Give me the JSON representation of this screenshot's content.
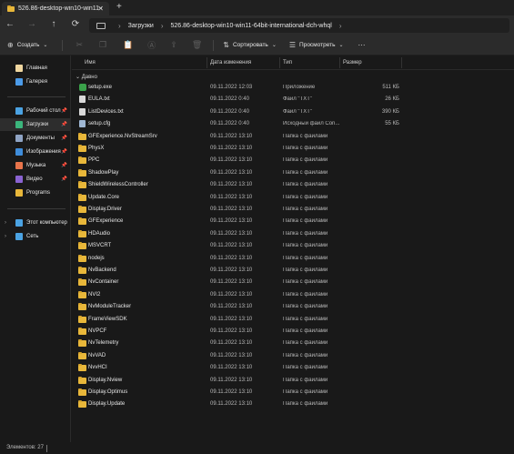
{
  "tab": {
    "title": "526.86-desktop-win10-win11-64...",
    "close": "✕",
    "new": "+"
  },
  "nav": {
    "back": "←",
    "forward": "→",
    "up": "↑",
    "refresh": "⟳"
  },
  "address": {
    "sep": "›",
    "crumbs": [
      "Загрузки",
      "526.86-desktop-win10-win11-64bit-international-dch-whql"
    ]
  },
  "commands": {
    "create": "Создать",
    "sort": "Сортировать",
    "view": "Просмотреть",
    "more": "···"
  },
  "sidebar": {
    "items": [
      {
        "label": "Главная",
        "icon": "home-icon",
        "color": "#f0d7a0"
      },
      {
        "label": "Галерея",
        "icon": "gallery-icon",
        "color": "#4c9be8"
      },
      {
        "label": "Рабочий стол",
        "icon": "desktop-icon",
        "color": "#4ba3e3",
        "pinned": true
      },
      {
        "label": "Загрузки",
        "icon": "downloads-icon",
        "color": "#3bb57c",
        "pinned": true
      },
      {
        "label": "Документы",
        "icon": "documents-icon",
        "color": "#8fa4c4",
        "pinned": true
      },
      {
        "label": "Изображения",
        "icon": "pictures-icon",
        "color": "#3f8ddb",
        "pinned": true
      },
      {
        "label": "Музыка",
        "icon": "music-icon",
        "color": "#e8744b",
        "pinned": true
      },
      {
        "label": "Видео",
        "icon": "videos-icon",
        "color": "#8a63d2",
        "pinned": true
      },
      {
        "label": "Programs",
        "icon": "folder-icon",
        "color": "#e8b73a"
      },
      {
        "label": "Этот компьютер",
        "icon": "this-pc-icon",
        "color": "#4ba3e3"
      },
      {
        "label": "Сеть",
        "icon": "network-icon",
        "color": "#4ba3e3"
      }
    ],
    "pin_glyph": "📌",
    "chevron": "›"
  },
  "columns": {
    "name": "Имя",
    "date": "Дата изменения",
    "type": "Тип",
    "size": "Размер"
  },
  "group": {
    "label": "Давно",
    "chevron": "⌄"
  },
  "files": [
    {
      "name": "setup.exe",
      "date": "09.11.2022 12:03",
      "type": "Приложение",
      "size": "511 КБ",
      "kind": "exe"
    },
    {
      "name": "EULA.txt",
      "date": "09.11.2022 0:40",
      "type": "Файл \"TXT\"",
      "size": "26 КБ",
      "kind": "txt"
    },
    {
      "name": "ListDevices.txt",
      "date": "09.11.2022 0:40",
      "type": "Файл \"TXT\"",
      "size": "390 КБ",
      "kind": "txt"
    },
    {
      "name": "setup.cfg",
      "date": "09.11.2022 0:40",
      "type": "Исходный файл Con...",
      "size": "55 КБ",
      "kind": "cfg"
    },
    {
      "name": "GFExperience.NvStreamSrv",
      "date": "09.11.2022 13:10",
      "type": "Папка с файлами",
      "size": "",
      "kind": "folder"
    },
    {
      "name": "PhysX",
      "date": "09.11.2022 13:10",
      "type": "Папка с файлами",
      "size": "",
      "kind": "folder"
    },
    {
      "name": "PPC",
      "date": "09.11.2022 13:10",
      "type": "Папка с файлами",
      "size": "",
      "kind": "folder"
    },
    {
      "name": "ShadowPlay",
      "date": "09.11.2022 13:10",
      "type": "Папка с файлами",
      "size": "",
      "kind": "folder"
    },
    {
      "name": "ShieldWirelessController",
      "date": "09.11.2022 13:10",
      "type": "Папка с файлами",
      "size": "",
      "kind": "folder"
    },
    {
      "name": "Update.Core",
      "date": "09.11.2022 13:10",
      "type": "Папка с файлами",
      "size": "",
      "kind": "folder"
    },
    {
      "name": "Display.Driver",
      "date": "09.11.2022 13:10",
      "type": "Папка с файлами",
      "size": "",
      "kind": "folder"
    },
    {
      "name": "GFExperience",
      "date": "09.11.2022 13:10",
      "type": "Папка с файлами",
      "size": "",
      "kind": "folder"
    },
    {
      "name": "HDAudio",
      "date": "09.11.2022 13:10",
      "type": "Папка с файлами",
      "size": "",
      "kind": "folder"
    },
    {
      "name": "MSVCRT",
      "date": "09.11.2022 13:10",
      "type": "Папка с файлами",
      "size": "",
      "kind": "folder"
    },
    {
      "name": "nodejs",
      "date": "09.11.2022 13:10",
      "type": "Папка с файлами",
      "size": "",
      "kind": "folder"
    },
    {
      "name": "NvBackend",
      "date": "09.11.2022 13:10",
      "type": "Папка с файлами",
      "size": "",
      "kind": "folder"
    },
    {
      "name": "NvContainer",
      "date": "09.11.2022 13:10",
      "type": "Папка с файлами",
      "size": "",
      "kind": "folder"
    },
    {
      "name": "NVI2",
      "date": "09.11.2022 13:10",
      "type": "Папка с файлами",
      "size": "",
      "kind": "folder"
    },
    {
      "name": "NvModuleTracker",
      "date": "09.11.2022 13:10",
      "type": "Папка с файлами",
      "size": "",
      "kind": "folder"
    },
    {
      "name": "FrameViewSDK",
      "date": "09.11.2022 13:10",
      "type": "Папка с файлами",
      "size": "",
      "kind": "folder"
    },
    {
      "name": "NVPCF",
      "date": "09.11.2022 13:10",
      "type": "Папка с файлами",
      "size": "",
      "kind": "folder"
    },
    {
      "name": "NvTelemetry",
      "date": "09.11.2022 13:10",
      "type": "Папка с файлами",
      "size": "",
      "kind": "folder"
    },
    {
      "name": "NvVAD",
      "date": "09.11.2022 13:10",
      "type": "Папка с файлами",
      "size": "",
      "kind": "folder"
    },
    {
      "name": "NvvHCI",
      "date": "09.11.2022 13:10",
      "type": "Папка с файлами",
      "size": "",
      "kind": "folder"
    },
    {
      "name": "Display.Nview",
      "date": "09.11.2022 13:10",
      "type": "Папка с файлами",
      "size": "",
      "kind": "folder"
    },
    {
      "name": "Display.Optimus",
      "date": "09.11.2022 13:10",
      "type": "Папка с файлами",
      "size": "",
      "kind": "folder"
    },
    {
      "name": "Display.Update",
      "date": "09.11.2022 13:10",
      "type": "Папка с файлами",
      "size": "",
      "kind": "folder"
    }
  ],
  "status": {
    "text": "Элементов: 27"
  }
}
